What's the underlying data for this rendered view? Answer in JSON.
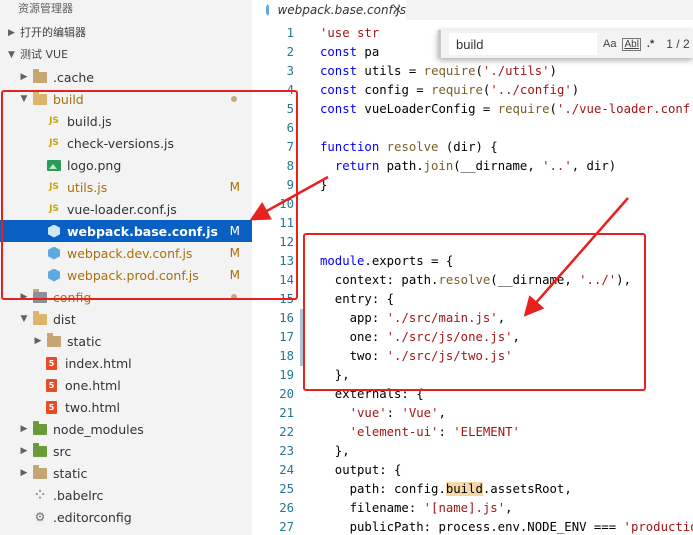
{
  "sidebar": {
    "title": "资源管理器",
    "open_editors": "打开的编辑器",
    "workspace": "测试 VUE",
    "rows": [
      {
        "name": ".cache"
      },
      {
        "name": "build"
      },
      {
        "name": "build.js"
      },
      {
        "name": "check-versions.js"
      },
      {
        "name": "logo.png"
      },
      {
        "name": "utils.js",
        "badge": "M"
      },
      {
        "name": "vue-loader.conf.js"
      },
      {
        "name": "webpack.base.conf.js",
        "badge": "M"
      },
      {
        "name": "webpack.dev.conf.js",
        "badge": "M"
      },
      {
        "name": "webpack.prod.conf.js",
        "badge": "M"
      },
      {
        "name": "config"
      },
      {
        "name": "dist"
      },
      {
        "name": "static"
      },
      {
        "name": "index.html"
      },
      {
        "name": "one.html"
      },
      {
        "name": "two.html"
      },
      {
        "name": "node_modules"
      },
      {
        "name": "src"
      },
      {
        "name": "static"
      },
      {
        "name": ".babelrc"
      },
      {
        "name": ".editorconfig"
      }
    ]
  },
  "editor": {
    "tab_label": "webpack.base.conf.js",
    "tab_close": "×",
    "find": {
      "value": "build",
      "case_label": "Aa",
      "word_label": "Abl",
      "regex_label": ".*",
      "count": "1 / 2"
    },
    "lines": [
      {
        "n": "1",
        "t": "'use str"
      },
      {
        "n": "2",
        "t": "const pa"
      },
      {
        "n": "3",
        "t": "const utils = require('./utils')"
      },
      {
        "n": "4",
        "t": "const config = require('../config')"
      },
      {
        "n": "5",
        "t": "const vueLoaderConfig = require('./vue-loader.conf')"
      },
      {
        "n": "6",
        "t": ""
      },
      {
        "n": "7",
        "t": "function resolve (dir) {"
      },
      {
        "n": "8",
        "t": "  return path.join(__dirname, '..', dir)"
      },
      {
        "n": "9",
        "t": "}"
      },
      {
        "n": "10",
        "t": ""
      },
      {
        "n": "11",
        "t": ""
      },
      {
        "n": "12",
        "t": ""
      },
      {
        "n": "13",
        "t": "module.exports = {"
      },
      {
        "n": "14",
        "t": "  context: path.resolve(__dirname, '../'),"
      },
      {
        "n": "15",
        "t": "  entry: {"
      },
      {
        "n": "16",
        "t": "    app: './src/main.js',"
      },
      {
        "n": "17",
        "t": "    one: './src/js/one.js',"
      },
      {
        "n": "18",
        "t": "    two: './src/js/two.js'"
      },
      {
        "n": "19",
        "t": "  },"
      },
      {
        "n": "20",
        "t": "  externals: {"
      },
      {
        "n": "21",
        "t": "    'vue': 'Vue',"
      },
      {
        "n": "22",
        "t": "    'element-ui': 'ELEMENT'"
      },
      {
        "n": "23",
        "t": "  },"
      },
      {
        "n": "24",
        "t": "  output: {"
      },
      {
        "n": "25",
        "t": "    path: config.build.assetsRoot,"
      },
      {
        "n": "26",
        "t": "    filename: '[name].js',"
      },
      {
        "n": "27",
        "t": "    publicPath: process.env.NODE_ENV === 'production'"
      }
    ]
  },
  "colors": {
    "selection": "#0960c2",
    "annotation": "#e8201e",
    "modified": "#a8700a"
  }
}
